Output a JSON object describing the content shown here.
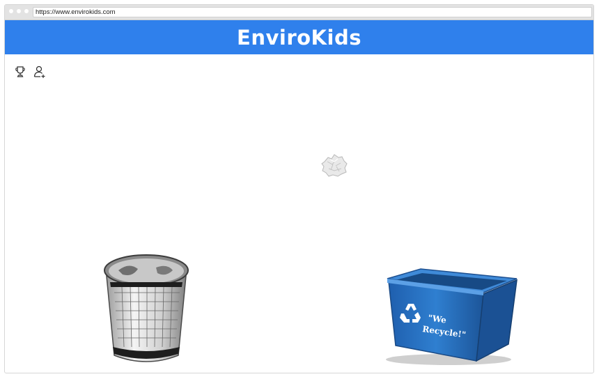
{
  "browser": {
    "url": "https://www.envirokids.com"
  },
  "header": {
    "title": "EnviroKids",
    "background_color": "#2f80ec"
  },
  "toolbar": {
    "icons": [
      "trophy-icon",
      "add-user-icon"
    ]
  },
  "game": {
    "draggable_item": "crumpled-paper",
    "bins": [
      {
        "name": "trash-can"
      },
      {
        "name": "recycling-bin",
        "label_line1": "\"We",
        "label_line2": "Recycle!\""
      }
    ],
    "recycle_color": "#2a6fbf"
  }
}
